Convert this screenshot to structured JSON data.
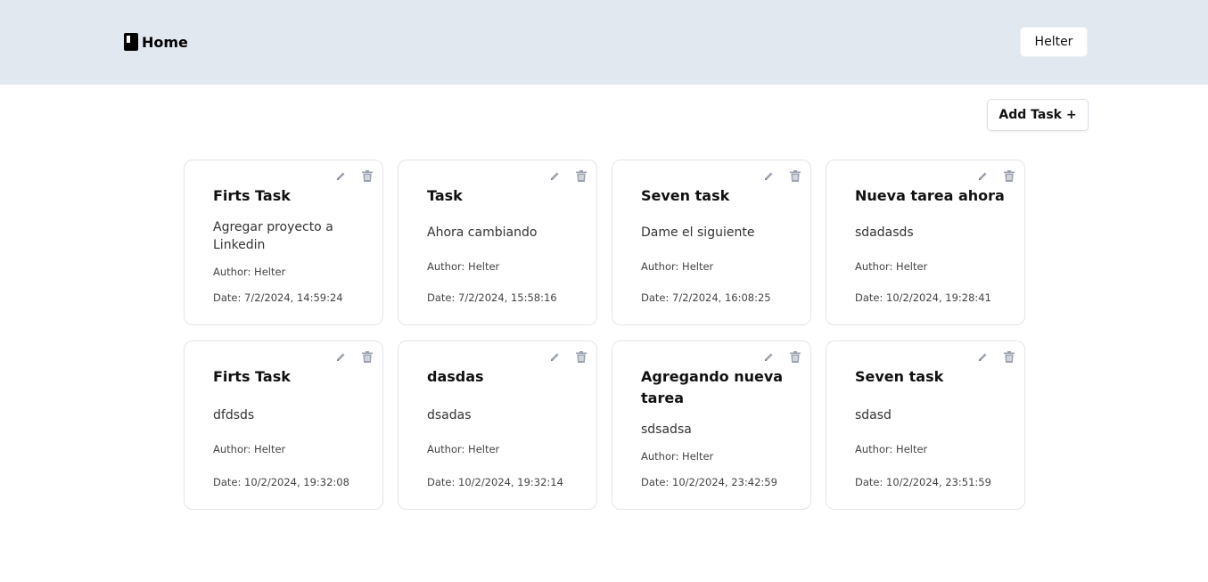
{
  "header": {
    "brand_label": "Home",
    "brand_icon": "book-icon",
    "user_button_label": "Helter",
    "background": "#e2e8f0"
  },
  "toolbar": {
    "add_task_label": "Add Task +"
  },
  "tasks": [
    {
      "title": "Firts Task",
      "description": "Agregar proyecto a Linkedin",
      "author": "Author: Helter",
      "date": "Date: 7/2/2024, 14:59:24"
    },
    {
      "title": "Task",
      "description": "Ahora cambiando",
      "author": "Author: Helter",
      "date": "Date: 7/2/2024, 15:58:16"
    },
    {
      "title": "Seven task",
      "description": "Dame el siguiente",
      "author": "Author: Helter",
      "date": "Date: 7/2/2024, 16:08:25"
    },
    {
      "title": "Nueva tarea ahora",
      "description": "sdadasds",
      "author": "Author: Helter",
      "date": "Date: 10/2/2024, 19:28:41"
    },
    {
      "title": "Firts Task",
      "description": "dfdsds",
      "author": "Author: Helter",
      "date": "Date: 10/2/2024, 19:32:08"
    },
    {
      "title": "dasdas",
      "description": "dsadas",
      "author": "Author: Helter",
      "date": "Date: 10/2/2024, 19:32:14"
    },
    {
      "title": "Agregando nueva tarea",
      "description": "sdsadsa",
      "author": "Author: Helter",
      "date": "Date: 10/2/2024, 23:42:59"
    },
    {
      "title": "Seven task",
      "description": "sdasd",
      "author": "Author: Helter",
      "date": "Date: 10/2/2024, 23:51:59"
    }
  ],
  "icons": {
    "edit": "pencil-icon",
    "delete": "trash-icon"
  },
  "colors": {
    "icon_gray": "#9ca3af",
    "card_border": "#e2e5ea"
  }
}
